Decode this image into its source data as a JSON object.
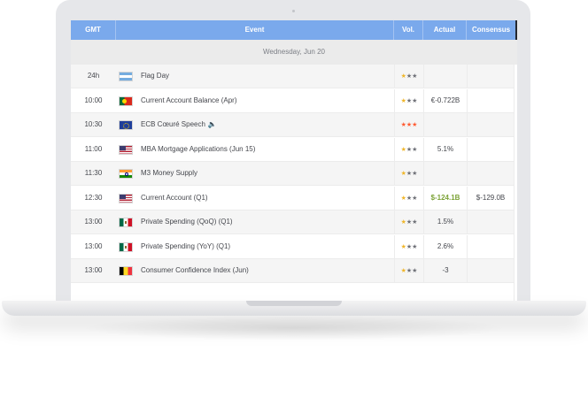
{
  "header": {
    "gmt": "GMT",
    "event": "Event",
    "vol": "Vol.",
    "actual": "Actual",
    "consensus": "Consensus"
  },
  "date_row": "Wednesday, Jun 20",
  "colors": {
    "header_bg": "#7aa9ec",
    "star_gold": "#f0b62a",
    "star_red": "#ff5b32",
    "positive": "#7ba236"
  },
  "rows": [
    {
      "time": "24h",
      "flag": "argentina-flag-icon",
      "event": "Flag Day",
      "speech": false,
      "volatility": "low",
      "stars": "★★★",
      "actual": "",
      "consensus": ""
    },
    {
      "time": "10:00",
      "flag": "portugal-flag-icon",
      "event": "Current Account Balance (Apr)",
      "speech": false,
      "volatility": "low",
      "stars": "★★★",
      "actual": "€-0.722B",
      "consensus": ""
    },
    {
      "time": "10:30",
      "flag": "eu-flag-icon",
      "event": "ECB Cœuré Speech",
      "speech": true,
      "speech_icon": "🔈",
      "volatility": "high",
      "stars": "★★★",
      "actual": "",
      "consensus": ""
    },
    {
      "time": "11:00",
      "flag": "us-flag-icon",
      "event": "MBA Mortgage Applications (Jun 15)",
      "speech": false,
      "volatility": "low",
      "stars": "★★★",
      "actual": "5.1%",
      "consensus": ""
    },
    {
      "time": "11:30",
      "flag": "india-flag-icon",
      "event": "M3 Money Supply",
      "speech": false,
      "volatility": "low",
      "stars": "★★★",
      "actual": "",
      "consensus": ""
    },
    {
      "time": "12:30",
      "flag": "us-flag-icon",
      "event": "Current Account (Q1)",
      "speech": false,
      "volatility": "low",
      "stars": "★★★",
      "actual": "$-124.1B",
      "actual_positive": true,
      "consensus": "$-129.0B"
    },
    {
      "time": "13:00",
      "flag": "mexico-flag-icon",
      "event": "Private Spending (QoQ) (Q1)",
      "speech": false,
      "volatility": "low",
      "stars": "★★★",
      "actual": "1.5%",
      "consensus": ""
    },
    {
      "time": "13:00",
      "flag": "mexico-flag-icon",
      "event": "Private Spending (YoY) (Q1)",
      "speech": false,
      "volatility": "low",
      "stars": "★★★",
      "actual": "2.6%",
      "consensus": ""
    },
    {
      "time": "13:00",
      "flag": "belgium-flag-icon",
      "event": "Consumer Confidence Index (Jun)",
      "speech": false,
      "volatility": "low",
      "stars": "★★★",
      "actual": "-3",
      "consensus": ""
    }
  ]
}
